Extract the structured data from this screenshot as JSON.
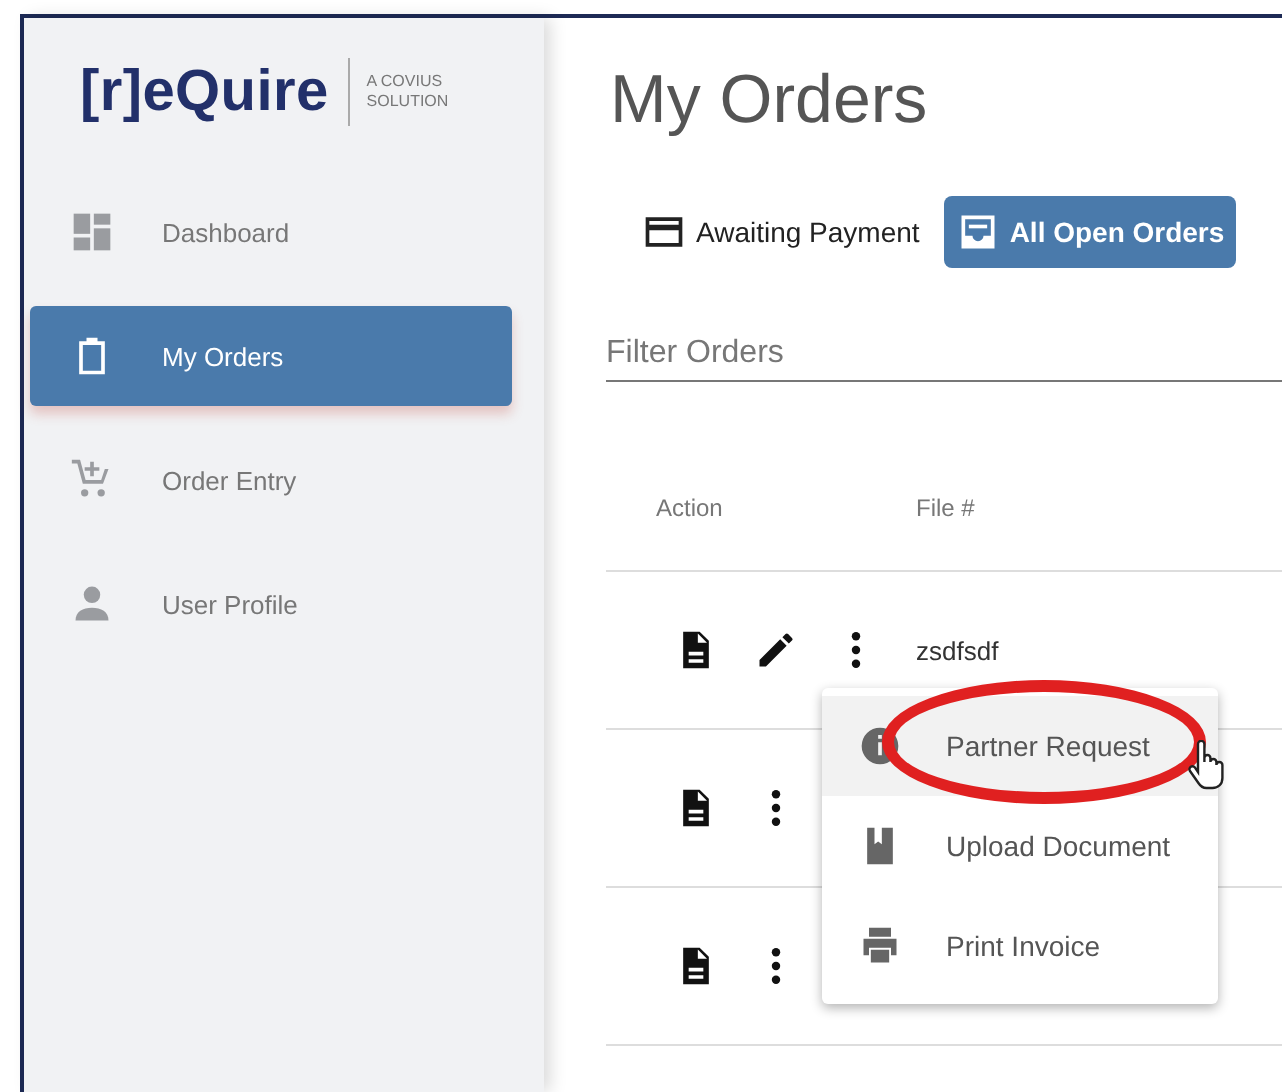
{
  "sidebar": {
    "logo": {
      "brand": "[r]eQuire",
      "tagline": [
        "A COVIUS",
        "SOLUTION"
      ]
    },
    "items": [
      {
        "label": "Dashboard",
        "selected": false
      },
      {
        "label": "My Orders",
        "selected": true
      },
      {
        "label": "Order Entry",
        "selected": false
      },
      {
        "label": "User Profile",
        "selected": false
      }
    ]
  },
  "page_title": "My Orders",
  "tabs": [
    {
      "label": "Awaiting Payment",
      "selected": false
    },
    {
      "label": "All Open Orders",
      "selected": true
    }
  ],
  "filter": {
    "placeholder": "Filter Orders"
  },
  "table": {
    "columns": [
      "Action",
      "File #"
    ],
    "rows": [
      {
        "editable": true,
        "file": "zsdfsdf"
      },
      {
        "editable": false
      },
      {
        "editable": false
      }
    ]
  },
  "menu": {
    "items": [
      {
        "label": "Partner Request",
        "hovered": true
      },
      {
        "label": "Upload Document",
        "hovered": false
      },
      {
        "label": "Print Invoice",
        "hovered": false
      }
    ]
  },
  "annotation": {
    "kind": "ellipse"
  },
  "cursor": {
    "kind": "hand"
  }
}
